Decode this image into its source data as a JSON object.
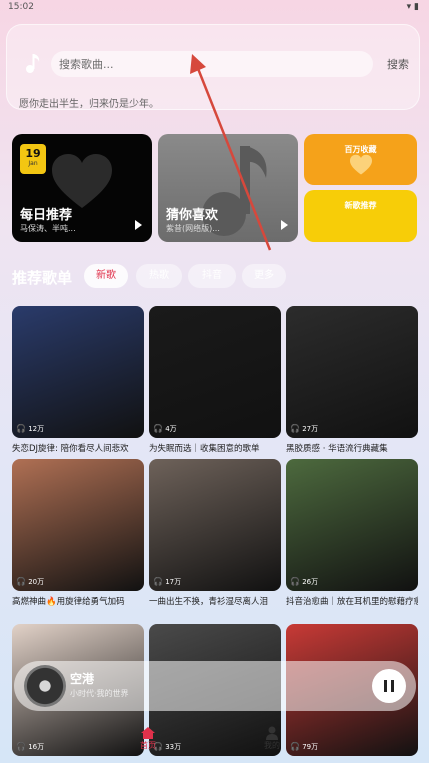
{
  "status": {
    "time": "15:02"
  },
  "search": {
    "placeholder": "搜索歌曲...",
    "button": "搜索",
    "slogan": "愿你走出半生，归来仍是少年。"
  },
  "cards": {
    "daily": {
      "day": "19",
      "month": "Jan",
      "title": "每日推荐",
      "subtitle": "马保涛、半吨..."
    },
    "guess": {
      "title": "猜你喜欢",
      "subtitle": "紫昔(网络版)..."
    },
    "top": {
      "label": "百万收藏"
    },
    "new": {
      "label": "新歌推荐"
    }
  },
  "section": {
    "title": "推荐歌单",
    "tabs": [
      "新歌",
      "热歌",
      "抖音",
      "更多"
    ],
    "active_tab": "新歌"
  },
  "playlists": [
    {
      "plays": "12万",
      "title": "失恋DJ旋律: 陪你看尽人间悲欢",
      "color": "#2a3b6b"
    },
    {
      "plays": "4万",
      "title": "为失眠而选｜收集困意的歌单",
      "color": "#1a1a1a"
    },
    {
      "plays": "27万",
      "title": "黑胶质感 · 华语流行典藏集",
      "color": "#2c2c2c"
    },
    {
      "plays": "20万",
      "title": "高燃神曲🔥用旋律给勇气加码",
      "color": "#b07054"
    },
    {
      "plays": "17万",
      "title": "一曲出生不换，青衫湿尽离人泪",
      "color": "#6e625a"
    },
    {
      "plays": "26万",
      "title": "抖音治愈曲｜放在耳机里的慰藉疗愈",
      "color": "#4d6a3e"
    },
    {
      "plays": "16万",
      "title": "",
      "color": "#e2d2c8"
    },
    {
      "plays": "33万",
      "title": "",
      "color": "#4a4a4a"
    },
    {
      "plays": "79万",
      "title": "",
      "color": "#c83a36"
    }
  ],
  "player": {
    "title": "空港",
    "artist": "小时代·我的世界"
  },
  "nav": {
    "home": "首页",
    "mine": "我的"
  },
  "colors": {
    "accent": "#e0314b",
    "orange": "#f5a21a",
    "yellow": "#f7cd08",
    "arrow": "#d6483c"
  }
}
